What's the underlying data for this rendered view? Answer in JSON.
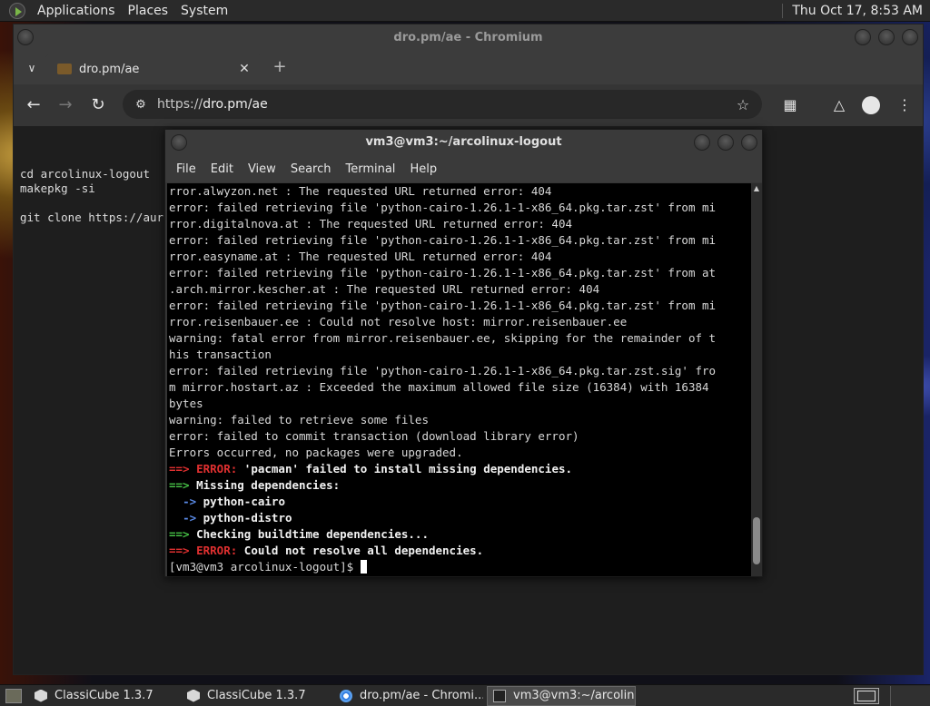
{
  "top_panel": {
    "menus": [
      "Applications",
      "Places",
      "System"
    ],
    "clock": "Thu Oct 17,  8:53 AM"
  },
  "browser": {
    "window_title": "dro.pm/ae - Chromium",
    "tab_title": "dro.pm/ae",
    "url_scheme": "https://",
    "url_host": "dro.pm/ae",
    "page_text": [
      "cd arcolinux-logout",
      "makepkg -si",
      "",
      "git clone https://aur"
    ]
  },
  "terminal": {
    "title": "vm3@vm3:~/arcolinux-logout",
    "menus": [
      "File",
      "Edit",
      "View",
      "Search",
      "Terminal",
      "Help"
    ],
    "lines": [
      "rror.alwyzon.net : The requested URL returned error: 404",
      "error: failed retrieving file 'python-cairo-1.26.1-1-x86_64.pkg.tar.zst' from mi",
      "rror.digitalnova.at : The requested URL returned error: 404",
      "error: failed retrieving file 'python-cairo-1.26.1-1-x86_64.pkg.tar.zst' from mi",
      "rror.easyname.at : The requested URL returned error: 404",
      "error: failed retrieving file 'python-cairo-1.26.1-1-x86_64.pkg.tar.zst' from at",
      ".arch.mirror.kescher.at : The requested URL returned error: 404",
      "error: failed retrieving file 'python-cairo-1.26.1-1-x86_64.pkg.tar.zst' from mi",
      "rror.reisenbauer.ee : Could not resolve host: mirror.reisenbauer.ee",
      "warning: fatal error from mirror.reisenbauer.ee, skipping for the remainder of t",
      "his transaction",
      "error: failed retrieving file 'python-cairo-1.26.1-1-x86_64.pkg.tar.zst.sig' fro",
      "m mirror.hostart.az : Exceeded the maximum allowed file size (16384) with 16384",
      "bytes",
      "warning: failed to retrieve some files",
      "error: failed to commit transaction (download library error)",
      "Errors occurred, no packages were upgraded."
    ],
    "arrow": "==>",
    "sub_arrow": "->",
    "error_label": "ERROR:",
    "error1_text": " 'pacman' failed to install missing dependencies.",
    "missing_label": " Missing dependencies:",
    "missing": [
      "python-cairo",
      "python-distro"
    ],
    "checking_text": " Checking buildtime dependencies...",
    "error2_text": " Could not resolve all dependencies.",
    "prompt": "[vm3@vm3 arcolinux-logout]$ "
  },
  "taskbar": {
    "tasks": [
      "ClassiCube 1.3.7",
      "ClassiCube 1.3.7",
      "dro.pm/ae - Chromi...",
      "vm3@vm3:~/arcolin..."
    ]
  }
}
